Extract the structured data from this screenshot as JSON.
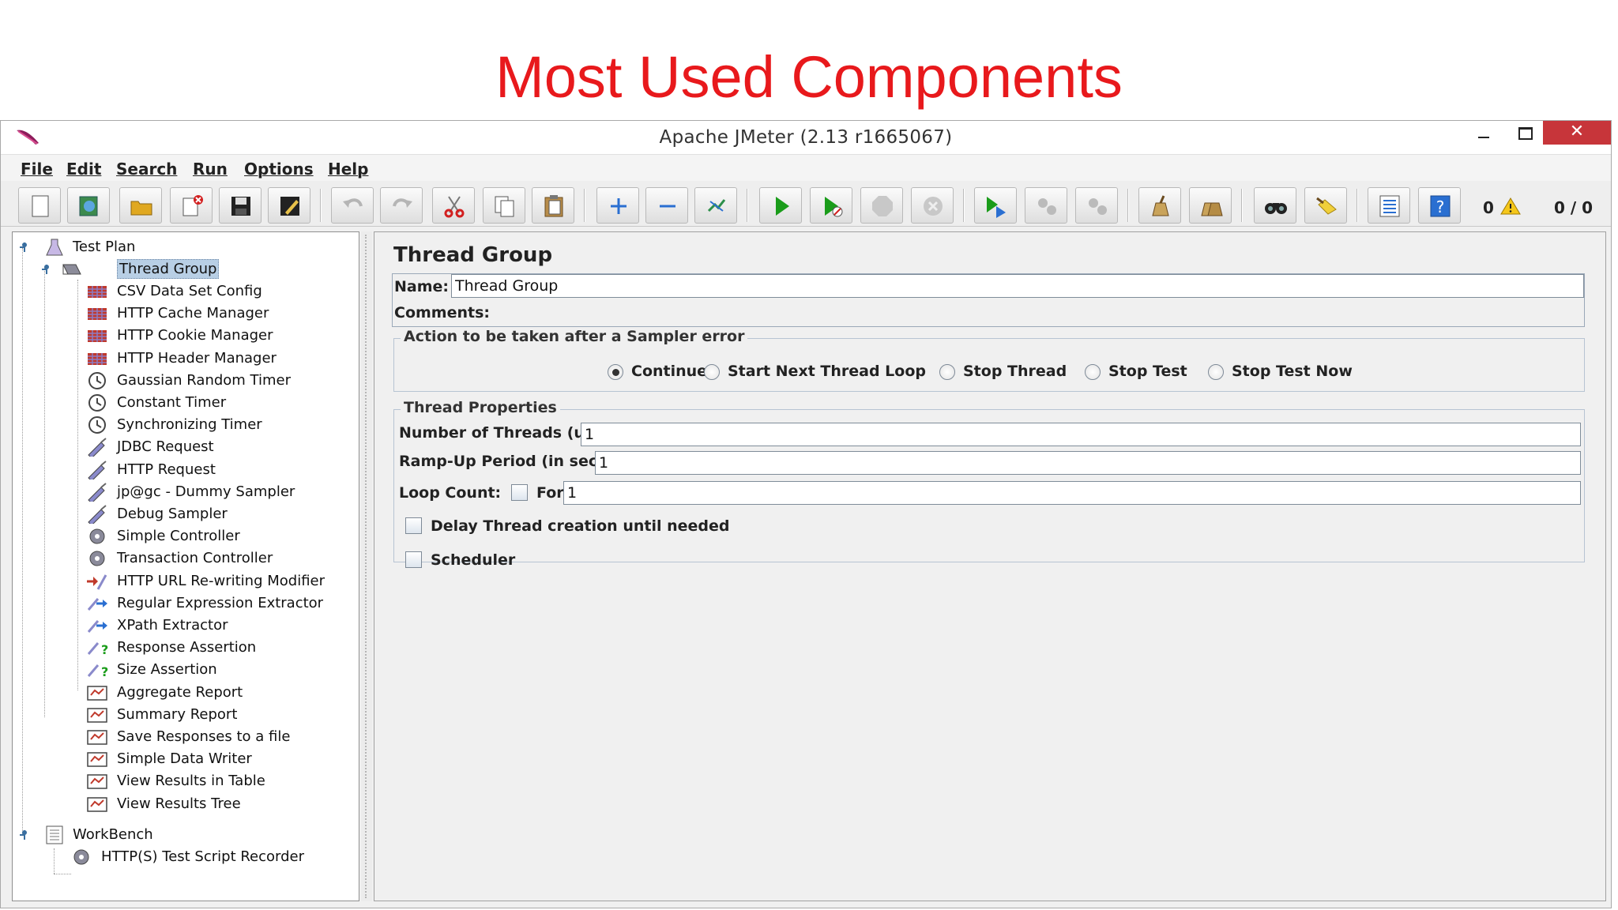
{
  "slide": {
    "title": "Most Used Components"
  },
  "window": {
    "title": "Apache JMeter (2.13 r1665067)",
    "close_glyph": "✕"
  },
  "menu": [
    "File",
    "Edit",
    "Search",
    "Run",
    "Options",
    "Help"
  ],
  "toolbar": {
    "buttons": [
      "new-icon",
      "templates-icon",
      "open-icon",
      "close-icon",
      "save-icon",
      "save-as-icon",
      "undo-icon",
      "redo-icon",
      "cut-icon",
      "copy-icon",
      "paste-icon",
      "expand-icon",
      "collapse-icon",
      "toggle-icon",
      "start-icon",
      "start-no-pauses-icon",
      "stop-icon",
      "shutdown-icon",
      "remote-start-icon",
      "remote-stop-icon",
      "remote-shutdown-icon",
      "clear-icon",
      "clear-all-icon",
      "search-icon",
      "reset-search-icon",
      "function-helper-icon",
      "help-icon"
    ],
    "error_count": "0",
    "thread_count": "0 / 0",
    "accent_colors": {
      "start": "#1a9c1a",
      "cut": "#d22020",
      "help": "#2a6fd1"
    }
  },
  "tree": {
    "root": "Test Plan",
    "thread_group": "Thread Group",
    "children": [
      {
        "label": "CSV Data Set Config",
        "icon": "config-icon"
      },
      {
        "label": "HTTP Cache Manager",
        "icon": "config-icon"
      },
      {
        "label": "HTTP Cookie Manager",
        "icon": "config-icon"
      },
      {
        "label": "HTTP Header Manager",
        "icon": "config-icon"
      },
      {
        "label": "Gaussian Random Timer",
        "icon": "timer-icon"
      },
      {
        "label": "Constant Timer",
        "icon": "timer-icon"
      },
      {
        "label": "Synchronizing Timer",
        "icon": "timer-icon"
      },
      {
        "label": "JDBC Request",
        "icon": "sampler-icon"
      },
      {
        "label": "HTTP Request",
        "icon": "sampler-icon"
      },
      {
        "label": "jp@gc - Dummy Sampler",
        "icon": "sampler-icon"
      },
      {
        "label": "Debug Sampler",
        "icon": "sampler-icon"
      },
      {
        "label": "Simple Controller",
        "icon": "controller-icon"
      },
      {
        "label": "Transaction Controller",
        "icon": "controller-icon"
      },
      {
        "label": "HTTP URL Re-writing Modifier",
        "icon": "preprocessor-icon"
      },
      {
        "label": "Regular Expression Extractor",
        "icon": "postprocessor-icon"
      },
      {
        "label": "XPath Extractor",
        "icon": "postprocessor-icon"
      },
      {
        "label": "Response Assertion",
        "icon": "assertion-icon"
      },
      {
        "label": "Size Assertion",
        "icon": "assertion-icon"
      },
      {
        "label": "Aggregate Report",
        "icon": "listener-icon"
      },
      {
        "label": "Summary Report",
        "icon": "listener-icon"
      },
      {
        "label": "Save Responses to a file",
        "icon": "listener-icon"
      },
      {
        "label": "Simple Data Writer",
        "icon": "listener-icon"
      },
      {
        "label": "View Results in Table",
        "icon": "listener-icon"
      },
      {
        "label": "View Results Tree",
        "icon": "listener-icon"
      }
    ],
    "workbench": "WorkBench",
    "recorder": "HTTP(S) Test Script Recorder"
  },
  "panel": {
    "title": "Thread Group",
    "name_label": "Name:",
    "name_value": "Thread Group",
    "comments_label": "Comments:",
    "error_action": {
      "legend": "Action to be taken after a Sampler error",
      "options": [
        "Continue",
        "Start Next Thread Loop",
        "Stop Thread",
        "Stop Test",
        "Stop Test Now"
      ],
      "selected": "Continue"
    },
    "thread_props": {
      "legend": "Thread Properties",
      "threads_label": "Number of Threads (users):",
      "threads_value": "1",
      "rampup_label": "Ramp-Up Period (in seconds):",
      "rampup_value": "1",
      "loop_label": "Loop Count:",
      "forever_label": "Forever",
      "forever_checked": false,
      "loop_value": "1",
      "delay_label": "Delay Thread creation until needed",
      "delay_checked": false,
      "scheduler_label": "Scheduler",
      "scheduler_checked": false
    }
  }
}
